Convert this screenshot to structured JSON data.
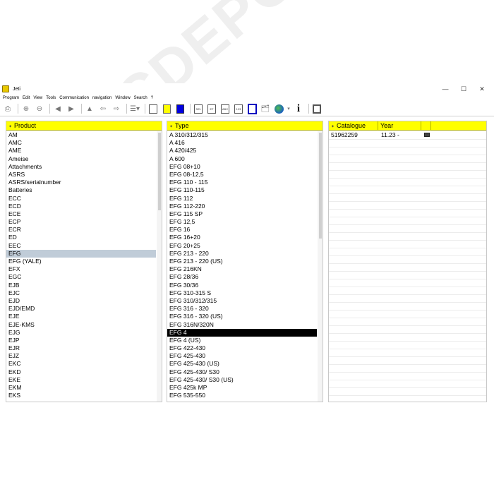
{
  "window": {
    "title": "Jeti",
    "minimize": "—",
    "maximize": "☐",
    "close": "✕"
  },
  "menu": [
    "Program",
    "Edit",
    "View",
    "Tools",
    "Communication",
    "navigation",
    "Window",
    "Search",
    "?"
  ],
  "toolbar": {
    "buttons_text": [
      "S/N",
      "ET",
      "ABC",
      "123"
    ]
  },
  "product_panel": {
    "header": "Product",
    "items": [
      "AM",
      "AMC",
      "AME",
      "Ameise",
      "Attachments",
      "ASRS",
      "ASRS/serialnumber",
      "Batteries",
      "ECC",
      "ECD",
      "ECE",
      "ECP",
      "ECR",
      "ED",
      "EEC",
      "EFG",
      "EFG (YALE)",
      "EFX",
      "EGC",
      "EJB",
      "EJC",
      "EJD",
      "EJD/EMD",
      "EJE",
      "EJE-KMS",
      "EJG",
      "EJP",
      "EJR",
      "EJZ",
      "EKC",
      "EKD",
      "EKE",
      "EKM",
      "EKS"
    ],
    "selected": "EFG"
  },
  "type_panel": {
    "header": "Type",
    "items": [
      "A 310/312/315",
      "A 416",
      "A 420/425",
      "A 600",
      "EFG 08+10",
      "EFG 08-12,5",
      "EFG 110 - 115",
      "EFG 110-115",
      "EFG 112",
      "EFG 112-220",
      "EFG 115 SP",
      "EFG 12,5",
      "EFG 16",
      "EFG 16+20",
      "EFG 20+25",
      "EFG 213 - 220",
      "EFG 213 - 220 (US)",
      "EFG 216KN",
      "EFG 28/36",
      "EFG 30/36",
      "EFG 310-315 S",
      "EFG 310/312/315",
      "EFG 316 - 320",
      "EFG 316 - 320 (US)",
      "EFG 316N/320N",
      "EFG 4",
      "EFG 4 (US)",
      "EFG 422-430",
      "EFG 425-430",
      "EFG 425-430 (US)",
      "EFG 425-430/ S30",
      "EFG 425-430/ S30 (US)",
      "EFG 425k MP",
      "EFG 535-550"
    ],
    "selected": "EFG 4"
  },
  "catalogue_panel": {
    "headers": {
      "catalogue": "Catalogue",
      "year": "Year"
    },
    "rows": [
      {
        "catalogue": "51962259",
        "year": "11.23 -",
        "icon": "pdf-icon"
      }
    ]
  },
  "watermark": "EPCDEPO.COM",
  "colors": {
    "header_yellow": "#ffff00",
    "selected_grey": "#c0ccd8",
    "selected_black": "#000000"
  }
}
